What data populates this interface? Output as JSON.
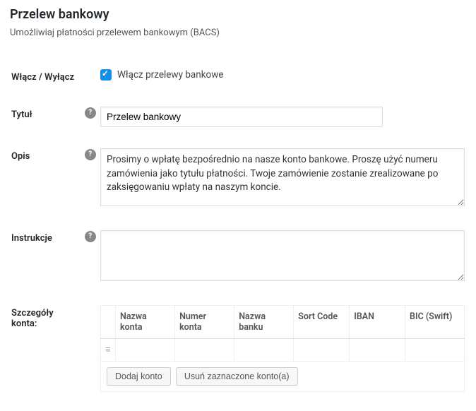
{
  "header": {
    "title": "Przelew bankowy",
    "subtitle": "Umożliwiaj płatności przelewem bankowym (BACS)"
  },
  "fields": {
    "enable_label": "Włącz / Wyłącz",
    "enable_checkbox_label": "Włącz przelewy bankowe",
    "title_label": "Tytuł",
    "title_value": "Przelew bankowy",
    "desc_label": "Opis",
    "desc_value": "Prosimy o wpłatę bezpośrednio na nasze konto bankowe. Proszę użyć numeru zamówienia jako tytułu płatności. Twoje zamówienie zostanie zrealizowane po zaksięgowaniu wpłaty na naszym koncie.",
    "instr_label": "Instrukcje",
    "instr_value": "",
    "accounts_label": "Szczegóły konta:"
  },
  "accounts": {
    "headers": {
      "name": "Nazwa konta",
      "number": "Numer konta",
      "bank": "Nazwa banku",
      "sort": "Sort Code",
      "iban": "IBAN",
      "bic": "BIC (Swift)"
    },
    "buttons": {
      "add": "Dodaj konto",
      "remove": "Usuń zaznaczone konto(a)"
    }
  },
  "icons": {
    "help": "?",
    "drag": "≡"
  }
}
